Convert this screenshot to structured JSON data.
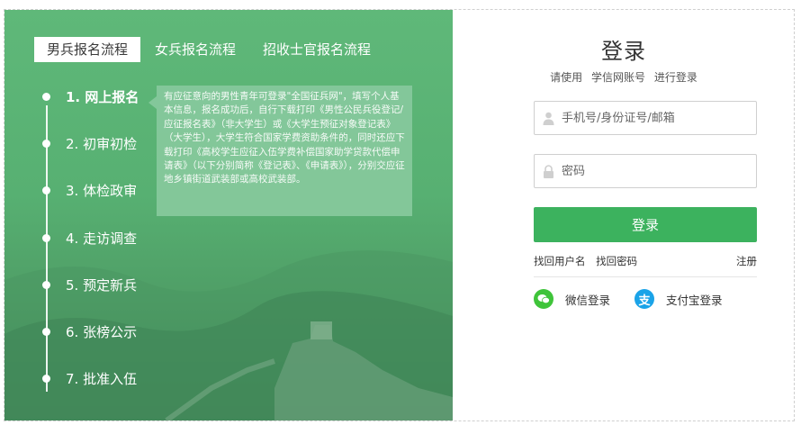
{
  "tabs": [
    "男兵报名流程",
    "女兵报名流程",
    "招收士官报名流程"
  ],
  "steps": [
    "1. 网上报名",
    "2. 初审初检",
    "3. 体检政审",
    "4. 走访调查",
    "5. 预定新兵",
    "6. 张榜公示",
    "7. 批准入伍"
  ],
  "tooltip": "有应征意向的男性青年可登录\"全国征兵网\"，填写个人基本信息，报名成功后，自行下载打印《男性公民兵役登记/应征报名表》（非大学生）或《大学生预征对象登记表》（大学生），大学生符合国家学费资助条件的，同时还应下载打印《高校学生应征入伍学费补偿国家助学贷款代偿申请表》（以下分别简称《登记表》、《申请表》），分别交应征 地乡镇街道武装部或高校武装部。",
  "login": {
    "title": "登录",
    "subtitle_prefix": "请使用",
    "subtitle_account": "学信网账号",
    "subtitle_suffix": "进行登录",
    "username_placeholder": "手机号/身份证号/邮箱",
    "password_placeholder": "密码",
    "submit_label": "登录",
    "find_username": "找回用户名",
    "find_password": "找回密码",
    "register": "注册",
    "wechat_login": "微信登录",
    "alipay_login": "支付宝登录"
  },
  "colors": {
    "brand_green": "#3cb25e",
    "panel_green": "#5fb879",
    "wechat": "#3fc43a",
    "alipay": "#1aa3e8"
  },
  "icons": [
    "user-icon",
    "lock-icon",
    "wechat-icon",
    "alipay-icon"
  ]
}
